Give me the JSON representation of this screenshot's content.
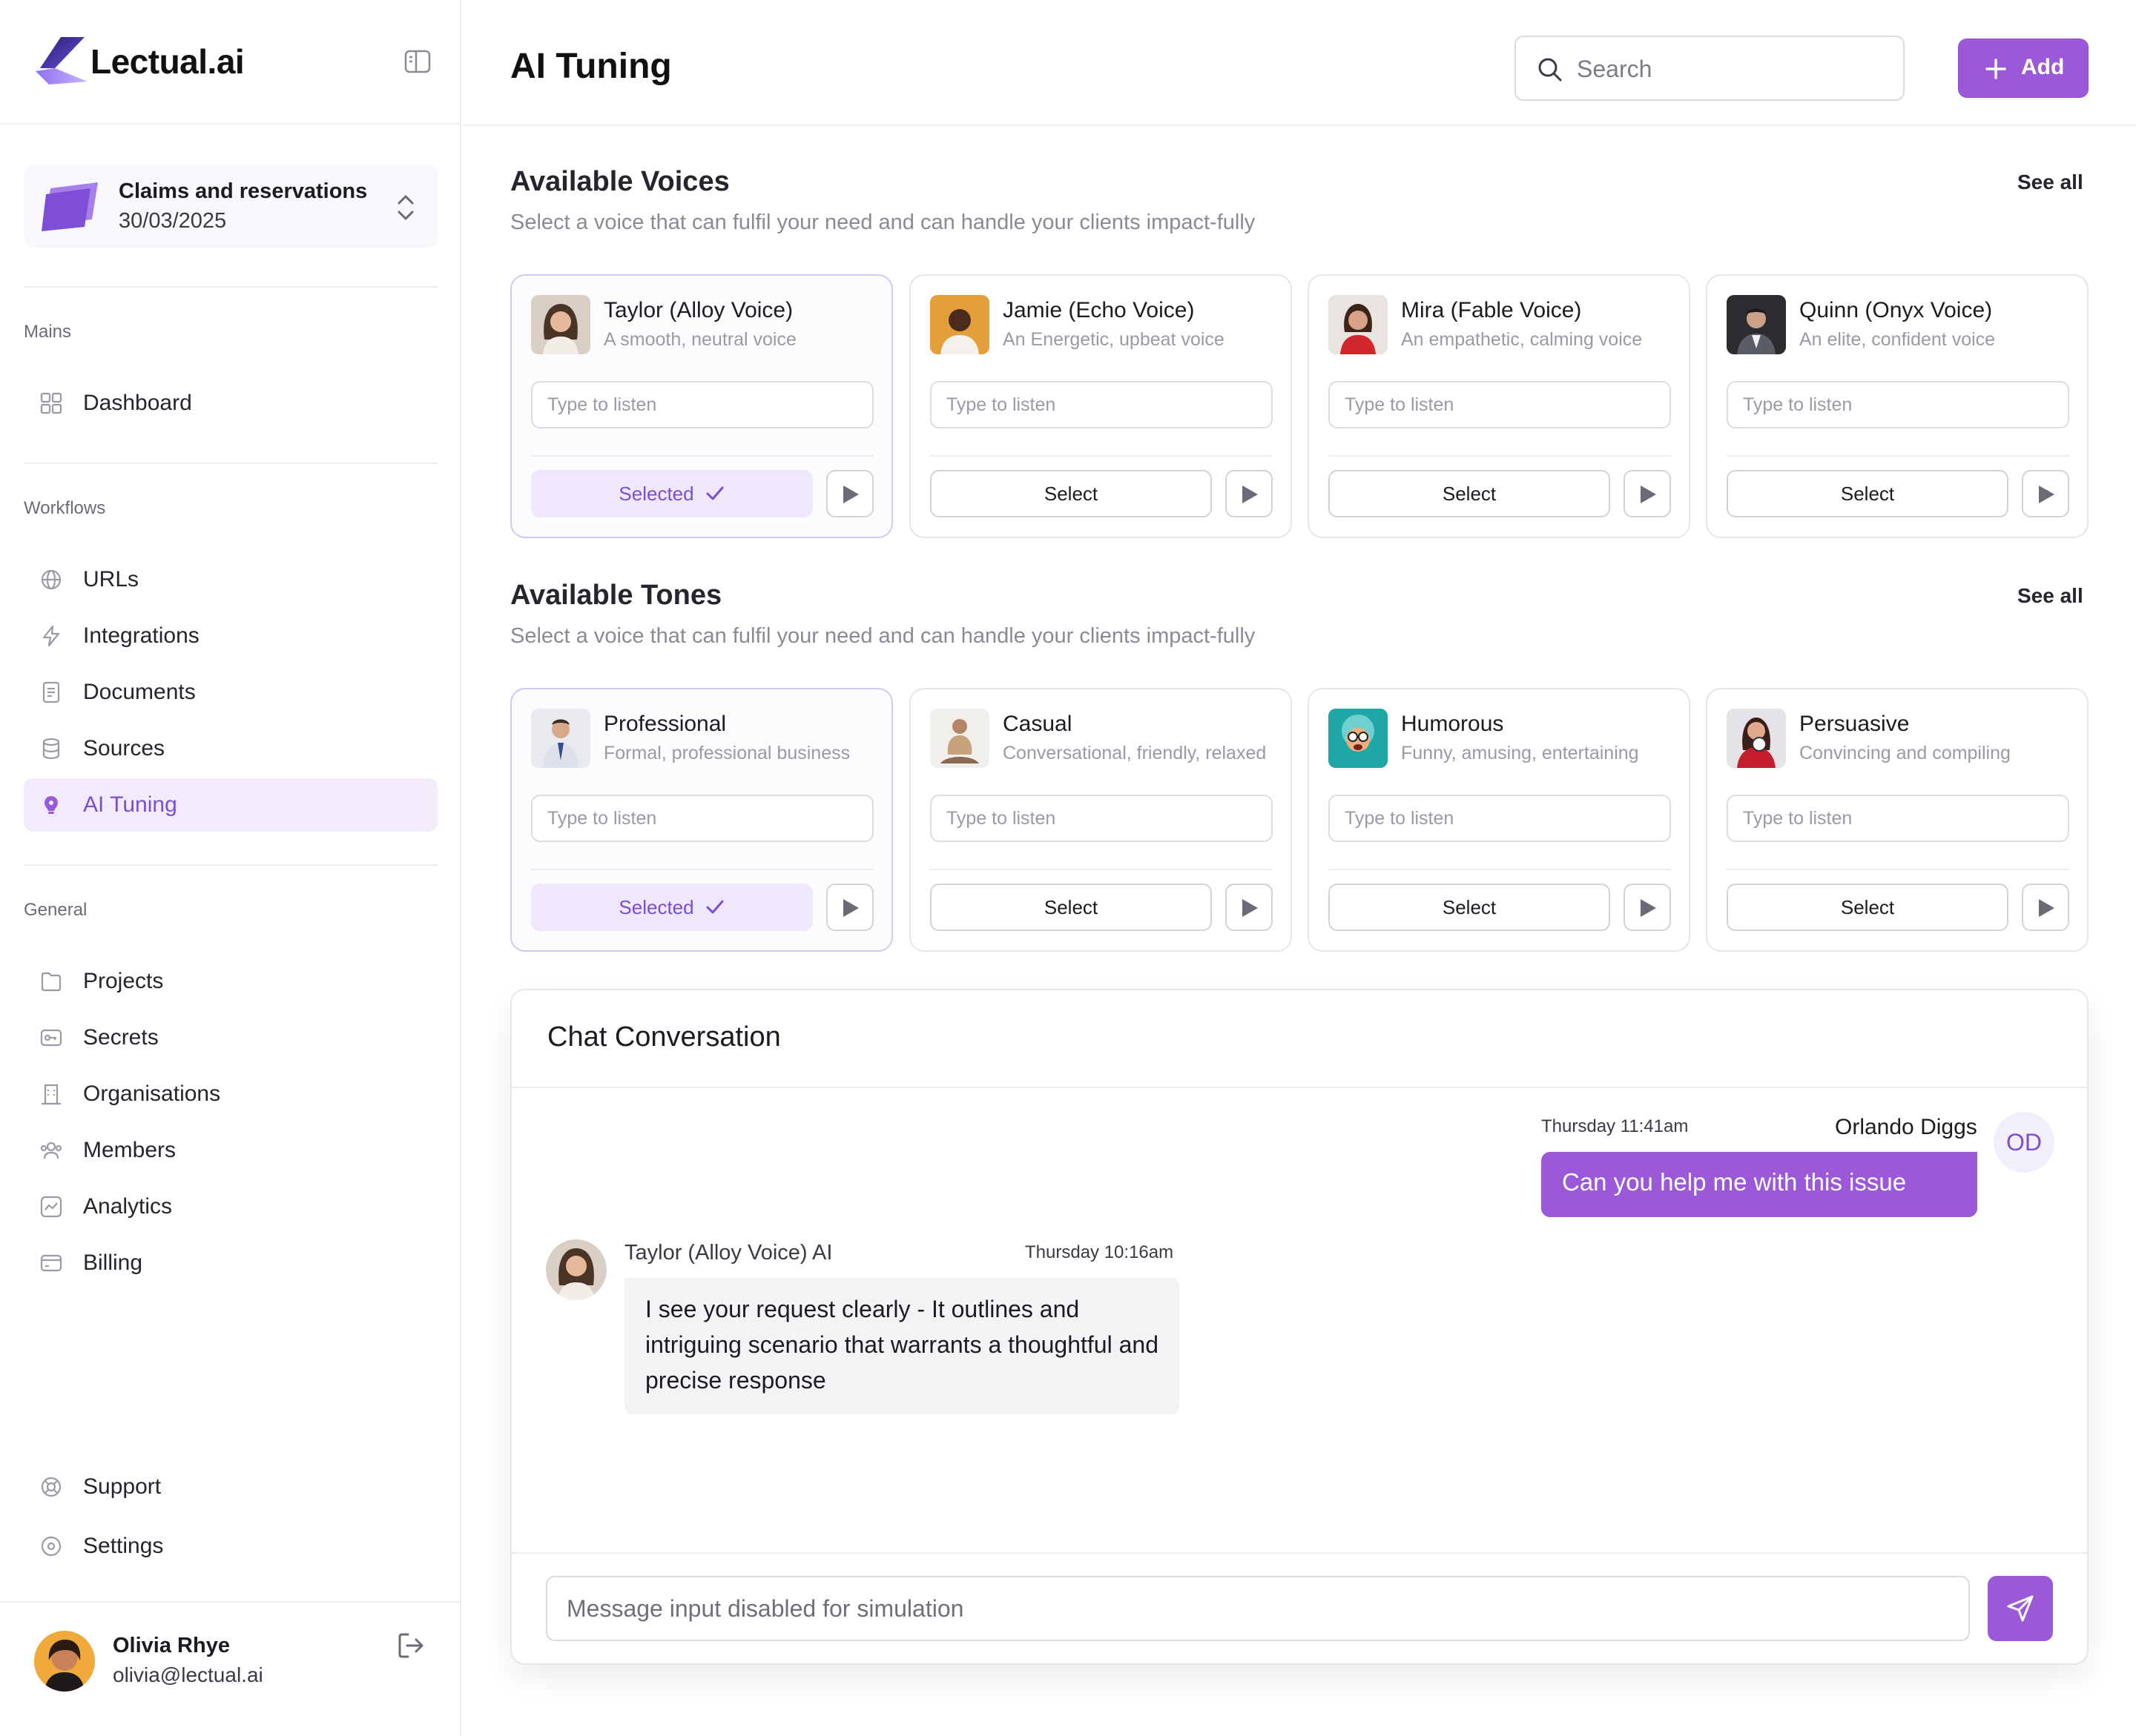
{
  "app": {
    "brand": "Lectual.ai",
    "accent": "#9b59d9"
  },
  "project": {
    "title": "Claims and reservations",
    "date": "30/03/2025"
  },
  "sidebar": {
    "mains_label": "Mains",
    "mains": [
      {
        "label": "Dashboard",
        "icon": "dashboard-icon"
      }
    ],
    "workflows_label": "Workflows",
    "workflows": [
      {
        "label": "URLs",
        "icon": "globe-icon"
      },
      {
        "label": "Integrations",
        "icon": "lightning-icon"
      },
      {
        "label": "Documents",
        "icon": "document-icon"
      },
      {
        "label": "Sources",
        "icon": "database-icon"
      },
      {
        "label": "AI Tuning",
        "icon": "bulb-icon",
        "active": true
      }
    ],
    "general_label": "General",
    "general": [
      {
        "label": "Projects",
        "icon": "folder-icon"
      },
      {
        "label": "Secrets",
        "icon": "key-icon"
      },
      {
        "label": "Organisations",
        "icon": "building-icon"
      },
      {
        "label": "Members",
        "icon": "users-icon"
      },
      {
        "label": "Analytics",
        "icon": "analytics-icon"
      },
      {
        "label": "Billing",
        "icon": "card-icon"
      }
    ],
    "bottom": [
      {
        "label": "Support",
        "icon": "lifebuoy-icon"
      },
      {
        "label": "Settings",
        "icon": "settings-icon"
      }
    ]
  },
  "user": {
    "name": "Olivia Rhye",
    "email": "olivia@lectual.ai"
  },
  "header": {
    "title": "AI Tuning",
    "search_placeholder": "Search",
    "add_label": "Add"
  },
  "voices": {
    "title": "Available Voices",
    "subtitle": "Select a voice that can fulfil your need and can handle your clients impact-fully",
    "see_all": "See all",
    "items": [
      {
        "name": "Taylor (Alloy Voice)",
        "desc": "A smooth, neutral voice",
        "placeholder": "Type to listen",
        "button": "Selected",
        "selected": true
      },
      {
        "name": "Jamie (Echo Voice)",
        "desc": "An Energetic, upbeat voice",
        "placeholder": "Type to listen",
        "button": "Select",
        "selected": false
      },
      {
        "name": "Mira (Fable Voice)",
        "desc": "An empathetic, calming voice",
        "placeholder": "Type to listen",
        "button": "Select",
        "selected": false
      },
      {
        "name": "Quinn (Onyx Voice)",
        "desc": "An elite, confident voice",
        "placeholder": "Type to listen",
        "button": "Select",
        "selected": false
      }
    ]
  },
  "tones": {
    "title": "Available Tones",
    "subtitle": "Select a voice that can fulfil your need and can handle your clients impact-fully",
    "see_all": "See all",
    "items": [
      {
        "name": "Professional",
        "desc": "Formal, professional business",
        "placeholder": "Type to listen",
        "button": "Selected",
        "selected": true
      },
      {
        "name": "Casual",
        "desc": "Conversational, friendly, relaxed",
        "placeholder": "Type to listen",
        "button": "Select",
        "selected": false
      },
      {
        "name": "Humorous",
        "desc": "Funny, amusing, entertaining",
        "placeholder": "Type to listen",
        "button": "Select",
        "selected": false
      },
      {
        "name": "Persuasive",
        "desc": "Convincing and compiling",
        "placeholder": "Type to listen",
        "button": "Select",
        "selected": false
      }
    ]
  },
  "chat": {
    "title": "Chat Conversation",
    "outgoing": {
      "time": "Thursday 11:41am",
      "sender": "Orlando Diggs",
      "initials": "OD",
      "text": "Can you help me with this issue"
    },
    "incoming": {
      "sender": "Taylor (Alloy Voice) AI",
      "time": "Thursday 10:16am",
      "text": "I see your request clearly - It outlines and intriguing scenario that warrants a thoughtful and precise response"
    },
    "input_placeholder": "Message input disabled for simulation"
  }
}
